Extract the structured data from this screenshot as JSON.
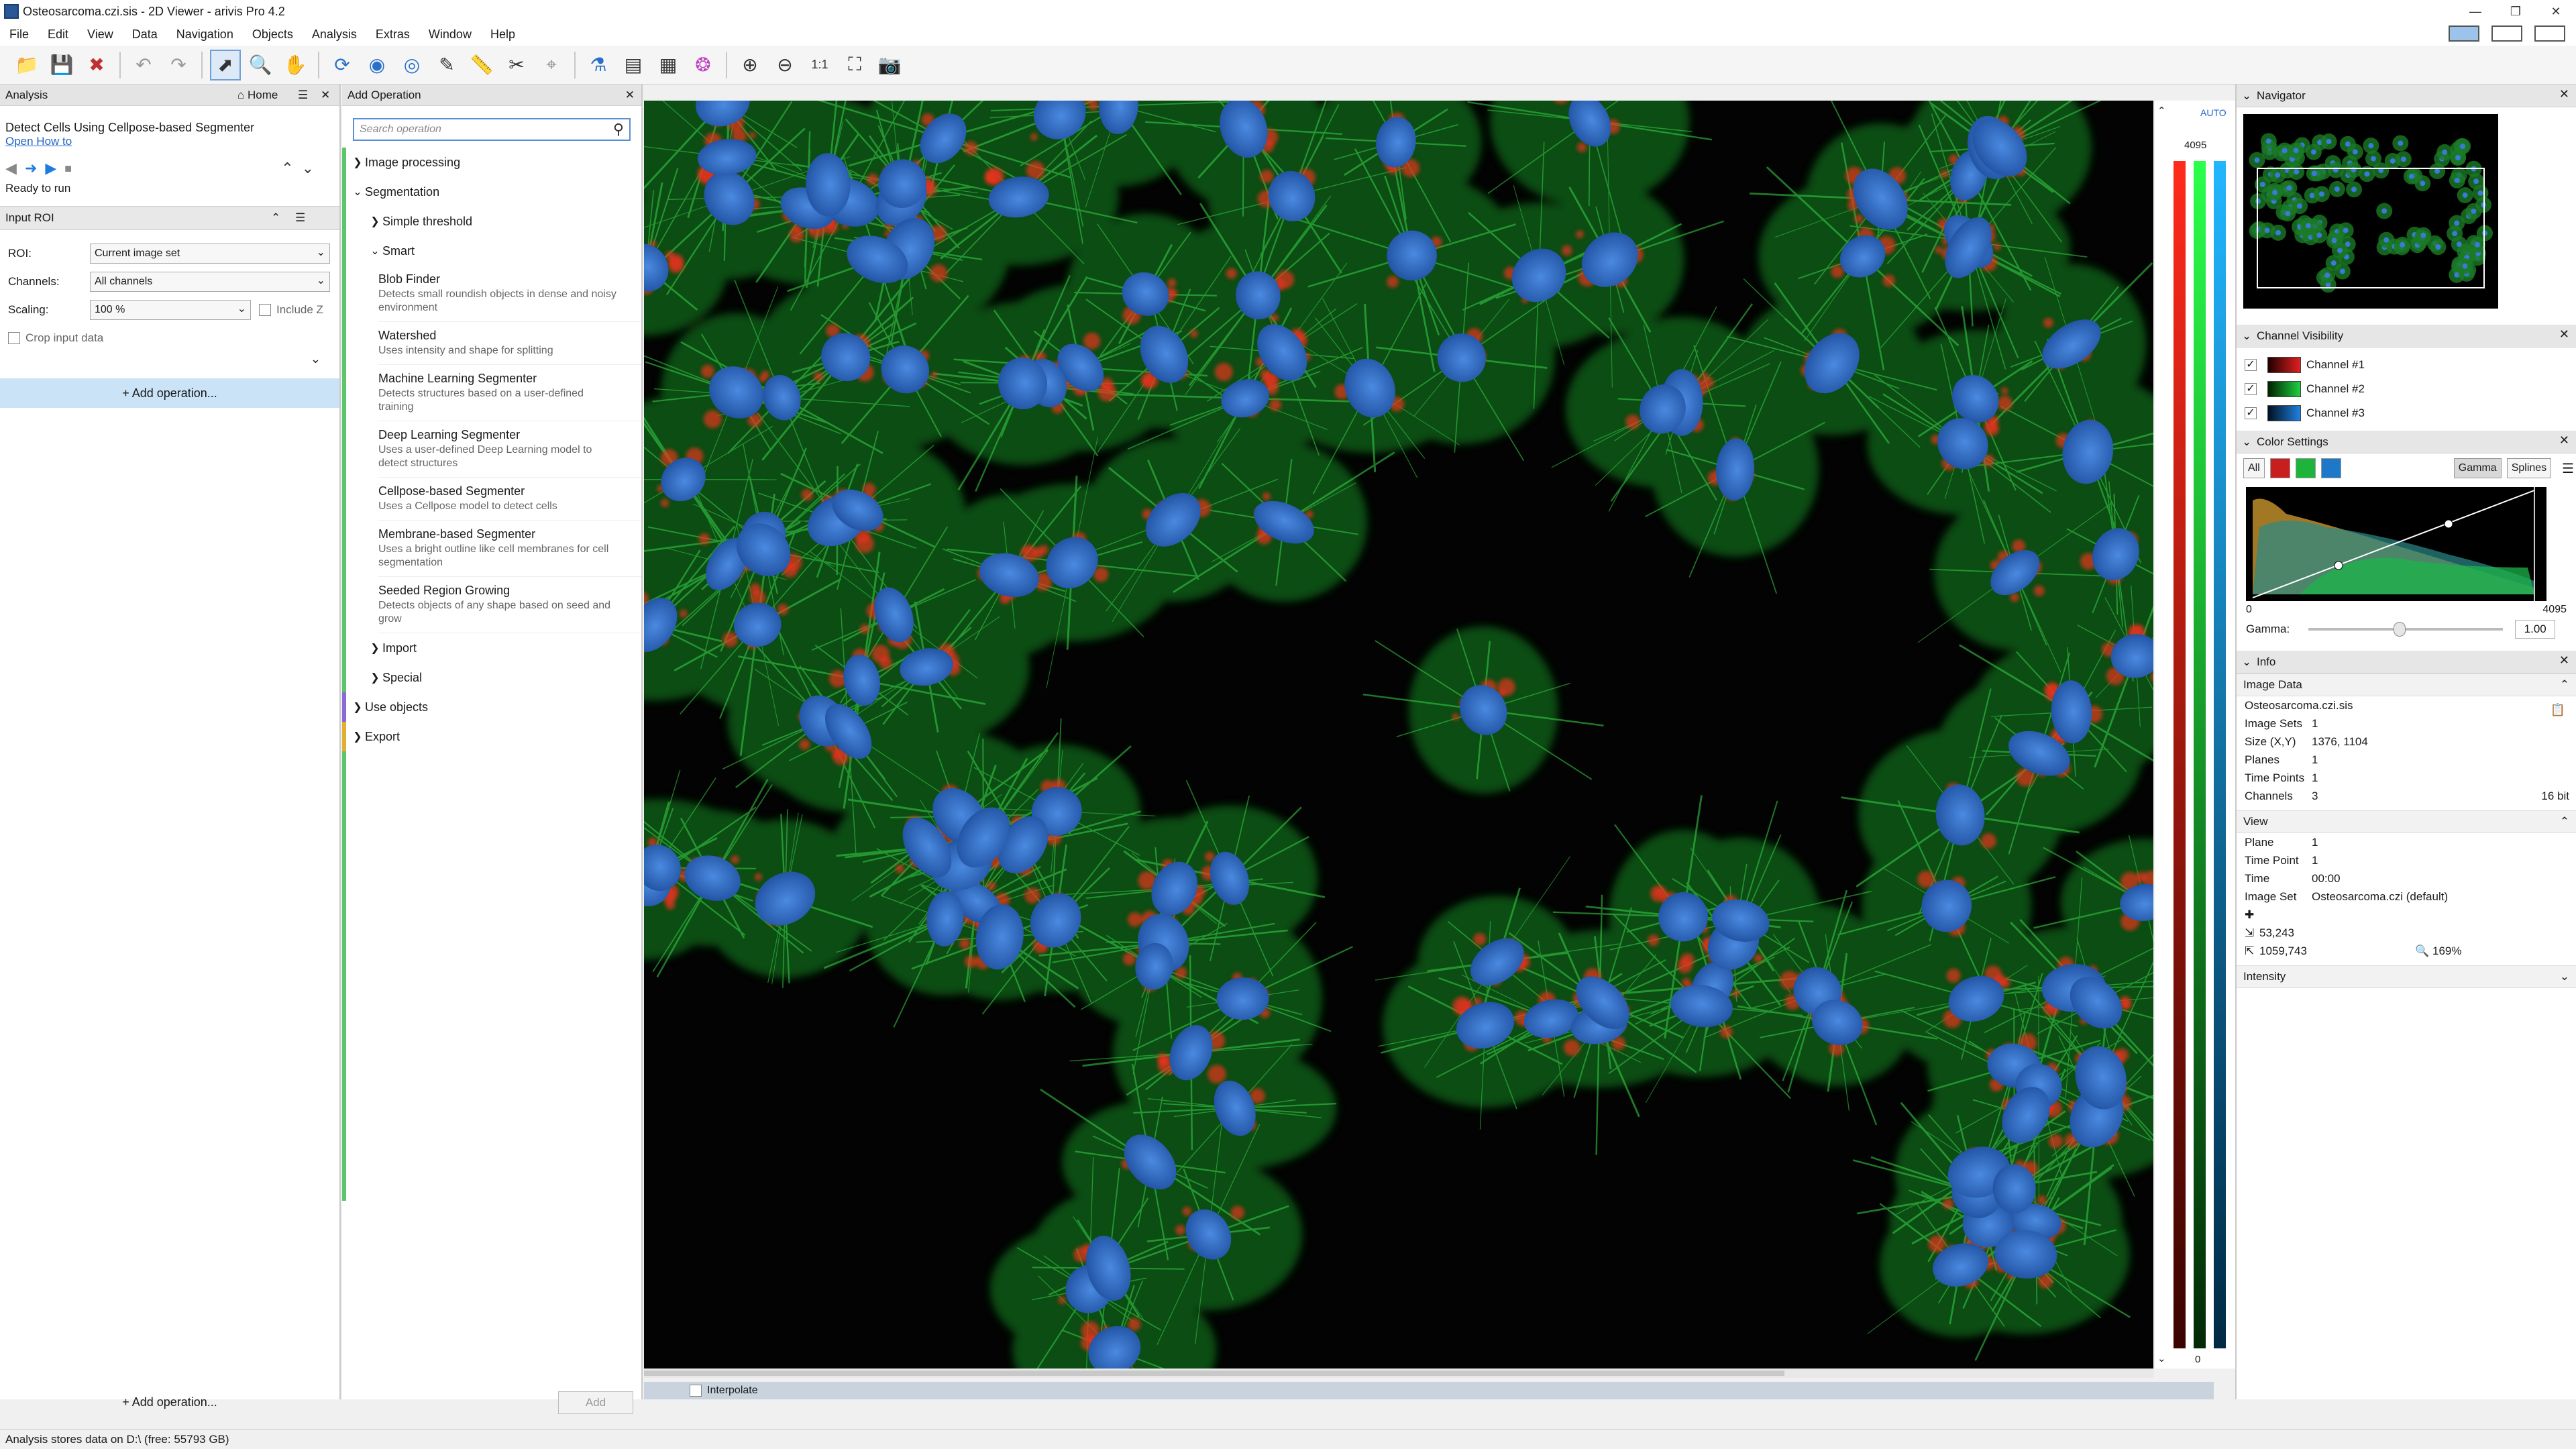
{
  "window": {
    "title": "Osteosarcoma.czi.sis - 2D Viewer - arivis Pro 4.2"
  },
  "menu": [
    "File",
    "Edit",
    "View",
    "Data",
    "Navigation",
    "Objects",
    "Analysis",
    "Extras",
    "Window",
    "Help"
  ],
  "analysis": {
    "header": "Analysis",
    "home": "Home",
    "task_title": "Detect Cells Using Cellpose-based Segmenter",
    "open_howto": "Open How to",
    "status": "Ready to run",
    "input_roi": "Input ROI",
    "roi_label": "ROI:",
    "roi_value": "Current image set",
    "channels_label": "Channels:",
    "channels_value": "All channels",
    "scaling_label": "Scaling:",
    "scaling_value": "100 %",
    "include_z": "Include Z",
    "crop_input": "Crop input data",
    "add_operation": "+ Add operation..."
  },
  "add_op": {
    "header": "Add Operation",
    "search_placeholder": "Search operation",
    "image_processing": "Image processing",
    "segmentation": "Segmentation",
    "simple_threshold": "Simple threshold",
    "smart": "Smart",
    "items": [
      {
        "title": "Blob Finder",
        "desc": "Detects small roundish objects in dense and noisy environment"
      },
      {
        "title": "Watershed",
        "desc": "Uses intensity and shape for splitting"
      },
      {
        "title": "Machine Learning Segmenter",
        "desc": "Detects structures based on a user-defined training"
      },
      {
        "title": "Deep Learning Segmenter",
        "desc": "Uses a user-defined Deep Learning model to detect structures"
      },
      {
        "title": "Cellpose-based Segmenter",
        "desc": "Uses a Cellpose model to detect cells"
      },
      {
        "title": "Membrane-based Segmenter",
        "desc": "Uses a bright outline like cell membranes for cell segmentation"
      },
      {
        "title": "Seeded Region Growing",
        "desc": "Detects objects of any shape based on seed and grow"
      }
    ],
    "import": "Import",
    "special": "Special",
    "use_objects": "Use objects",
    "export": "Export",
    "add_button": "Add"
  },
  "viewer": {
    "interpolate": "Interpolate"
  },
  "levels": {
    "auto": "AUTO",
    "max": "4095",
    "min": "0"
  },
  "navigator": {
    "header": "Navigator"
  },
  "channel_visibility": {
    "header": "Channel Visibility",
    "channels": [
      {
        "name": "Channel #1",
        "color": "#c81e1e"
      },
      {
        "name": "Channel #2",
        "color": "#1eb43c"
      },
      {
        "name": "Channel #3",
        "color": "#1e78c8"
      }
    ]
  },
  "color_settings": {
    "header": "Color Settings",
    "all": "All",
    "gamma_tab": "Gamma",
    "splines_tab": "Splines",
    "hist_min": "0",
    "hist_max": "4095",
    "gamma_label": "Gamma:",
    "gamma_value": "1.00",
    "gamma_slider_fraction": 0.47
  },
  "info": {
    "header": "Info",
    "image_data": "Image Data",
    "filename": "Osteosarcoma.czi.sis",
    "rows": [
      {
        "k": "Image Sets",
        "v": "1"
      },
      {
        "k": "Size (X,Y)",
        "v": "1376, 1104"
      },
      {
        "k": "Planes",
        "v": "1"
      },
      {
        "k": "Time Points",
        "v": "1"
      },
      {
        "k": "Channels",
        "v": "3",
        "extra": "16 bit"
      }
    ],
    "view": "View",
    "view_rows": [
      {
        "k": "Plane",
        "v": "1"
      },
      {
        "k": "Time Point",
        "v": "1"
      },
      {
        "k": "Time",
        "v": "00:00"
      },
      {
        "k": "Image Set",
        "v": "Osteosarcoma.czi (default)"
      }
    ],
    "coord1": "53,243",
    "coord2": "1059,743",
    "zoom": "169%",
    "intensity": "Intensity"
  },
  "statusbar": {
    "text": "Analysis stores data on D:\\ (free: 55793 GB)"
  }
}
